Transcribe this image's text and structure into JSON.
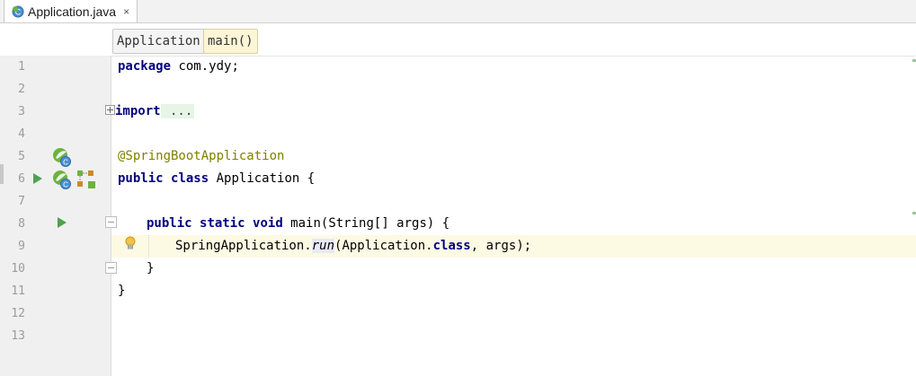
{
  "tab": {
    "filename": "Application.java",
    "close_glyph": "×"
  },
  "breadcrumb": [
    {
      "label": "Application"
    },
    {
      "label": "main()"
    }
  ],
  "lines": [
    "1",
    "2",
    "3",
    "4",
    "5",
    "6",
    "7",
    "8",
    "9",
    "10",
    "11",
    "12",
    "13"
  ],
  "code": {
    "l1_kw": "package",
    "l1_rest": " com.ydy;",
    "l3_kw": "import",
    "l3_fold": " ...",
    "l6_ann": "@SpringBootApplication",
    "l7_kw1": "public",
    "l7_kw2": "class",
    "l7_rest": " Application {",
    "l9_kw1": "public",
    "l9_kw2": "static",
    "l9_kw3": "void",
    "l9_rest": " main(String[] args) {",
    "l10_a": "SpringApplication.",
    "l10_run": "run",
    "l10_b": "(Application.",
    "l10_kw": "class",
    "l10_c": ", args);",
    "l11": "}",
    "l12": "}"
  },
  "colors": {
    "keyword": "#000080",
    "annotation": "#808000",
    "run": "#4ea24e",
    "spring_green": "#6db33f"
  }
}
